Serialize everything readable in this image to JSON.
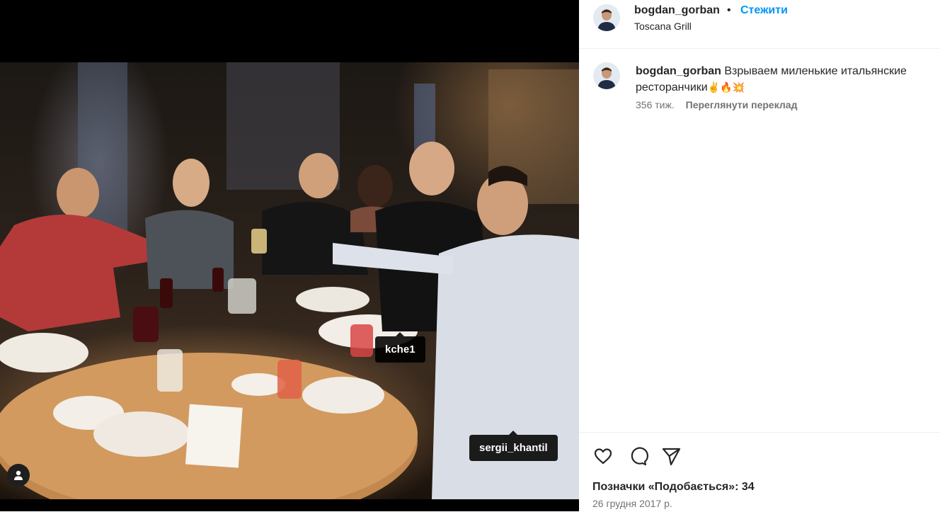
{
  "post": {
    "username": "bogdan_gorban",
    "follow_label": "Стежити",
    "separator": "•",
    "location": "Toscana Grill",
    "caption": {
      "username": "bogdan_gorban",
      "text": "Взрываем миленькие итальянские ресторанчики",
      "emojis": "✌️🔥💥",
      "time": "356 тиж.",
      "translate_label": "Переглянути переклад"
    },
    "likes_label": "Позначки «Подобається»: 34",
    "date": "26 грудня 2017 р."
  },
  "photo_tags": [
    {
      "username": "kche1"
    },
    {
      "username": "sergii_khantil"
    }
  ],
  "icons": {
    "like": "heart-icon",
    "comment": "comment-icon",
    "share": "send-icon",
    "tagged_users": "user-icon"
  },
  "colors": {
    "accent": "#0095f6",
    "text": "#262626",
    "secondary": "#737373",
    "media_bg": "#000000"
  }
}
